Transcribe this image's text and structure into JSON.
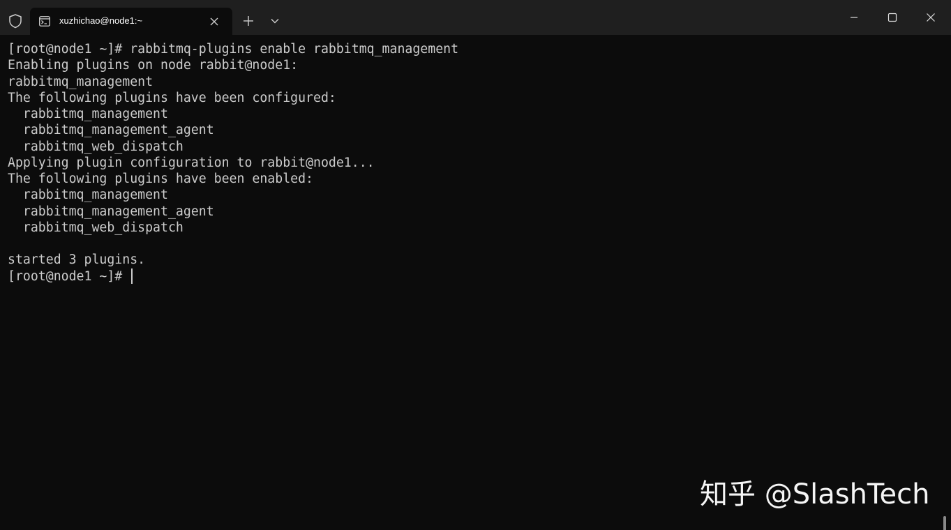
{
  "titlebar": {
    "shield_icon": "shield-icon",
    "tab": {
      "title": "xuzhichao@node1:~",
      "icon": "terminal-icon",
      "close_icon": "close-icon"
    },
    "new_tab_icon": "plus-icon",
    "dropdown_icon": "chevron-down-icon",
    "window_controls": [
      "minimize-icon",
      "maximize-icon",
      "close-icon"
    ]
  },
  "terminal": {
    "lines": [
      "[root@node1 ~]# rabbitmq-plugins enable rabbitmq_management",
      "Enabling plugins on node rabbit@node1:",
      "rabbitmq_management",
      "The following plugins have been configured:",
      "  rabbitmq_management",
      "  rabbitmq_management_agent",
      "  rabbitmq_web_dispatch",
      "Applying plugin configuration to rabbit@node1...",
      "The following plugins have been enabled:",
      "  rabbitmq_management",
      "  rabbitmq_management_agent",
      "  rabbitmq_web_dispatch",
      "",
      "started 3 plugins."
    ],
    "prompt": "[root@node1 ~]# "
  },
  "watermark": "知乎 @SlashTech",
  "colors": {
    "titlebar": "#1f1f1f",
    "terminal_bg": "#0c0c0c",
    "text": "#cccccc"
  }
}
